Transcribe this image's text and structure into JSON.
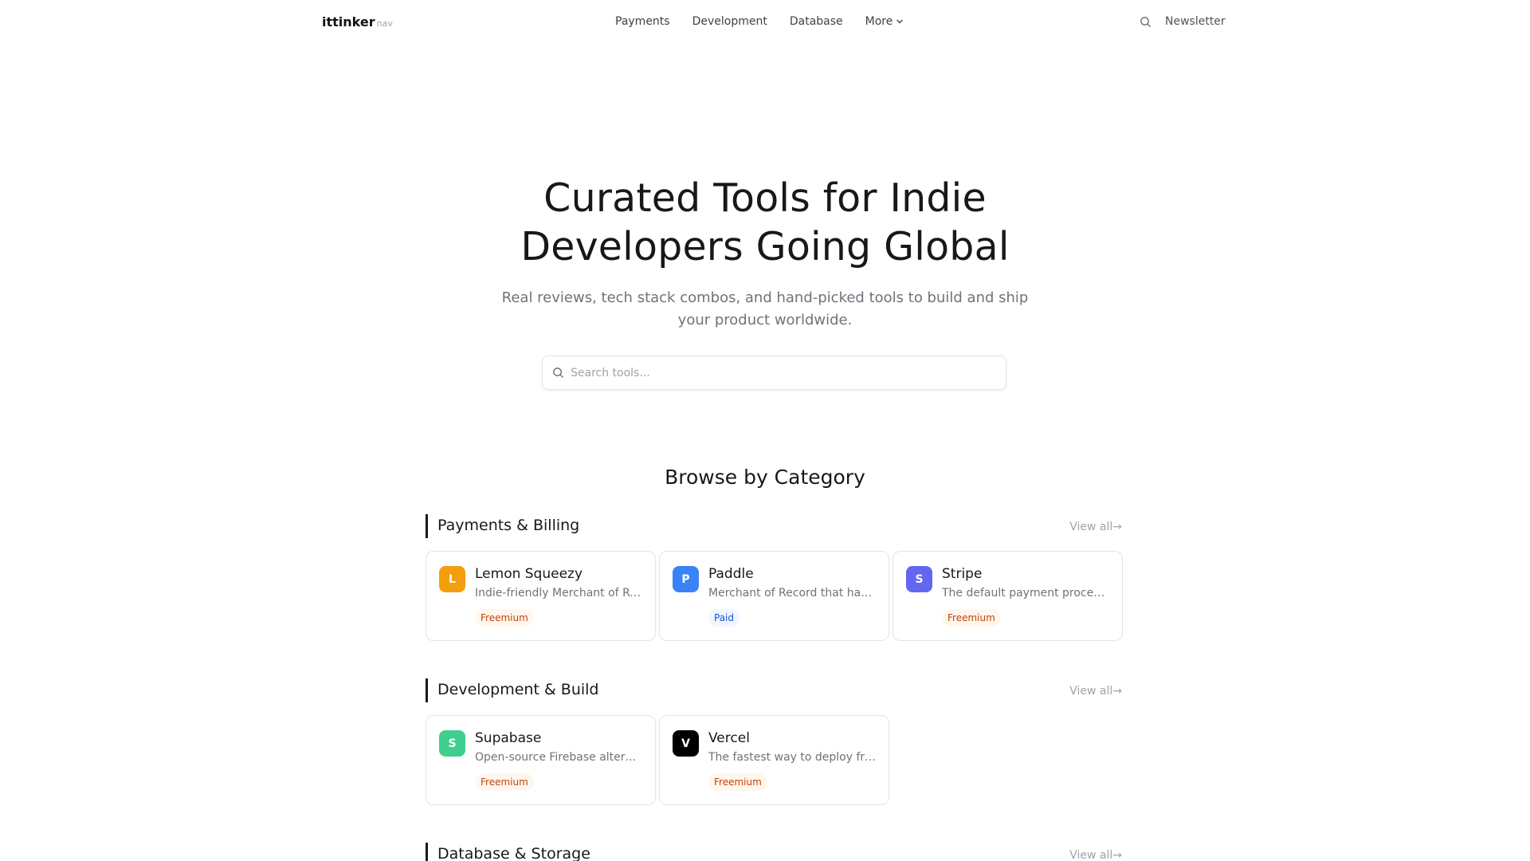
{
  "nav": {
    "brand": "ittinker",
    "brand_suffix": "nav",
    "links": [
      "Payments",
      "Development",
      "Database"
    ],
    "more_label": "More",
    "newsletter_label": "Newsletter"
  },
  "hero": {
    "title_line1": "Curated Tools for Indie",
    "title_line2": "Developers Going Global",
    "subtitle": "Real reviews, tech stack combos, and hand-picked tools to build and ship your product worldwide."
  },
  "search": {
    "placeholder": "Search tools..."
  },
  "browse_title": "Browse by Category",
  "view_all_label": "View all→",
  "sections": [
    {
      "title": "Payments & Billing",
      "tools": [
        {
          "initial": "L",
          "name": "Lemon Squeezy",
          "desc": "Indie-friendly Merchant of Record",
          "badge": "Freemium",
          "color": "#f59e0b"
        },
        {
          "initial": "P",
          "name": "Paddle",
          "desc": "Merchant of Record that handles taxes",
          "badge": "Paid",
          "color": "#3b82f6"
        },
        {
          "initial": "S",
          "name": "Stripe",
          "desc": "The default payment processor",
          "badge": "Freemium",
          "color": "#6366f1"
        }
      ]
    },
    {
      "title": "Development & Build",
      "tools": [
        {
          "initial": "S",
          "name": "Supabase",
          "desc": "Open-source Firebase alternative",
          "badge": "Freemium",
          "color": "#3ecf8e"
        },
        {
          "initial": "V",
          "name": "Vercel",
          "desc": "The fastest way to deploy frontends",
          "badge": "Freemium",
          "color": "#000000"
        }
      ]
    },
    {
      "title": "Database & Storage",
      "tools": []
    }
  ]
}
